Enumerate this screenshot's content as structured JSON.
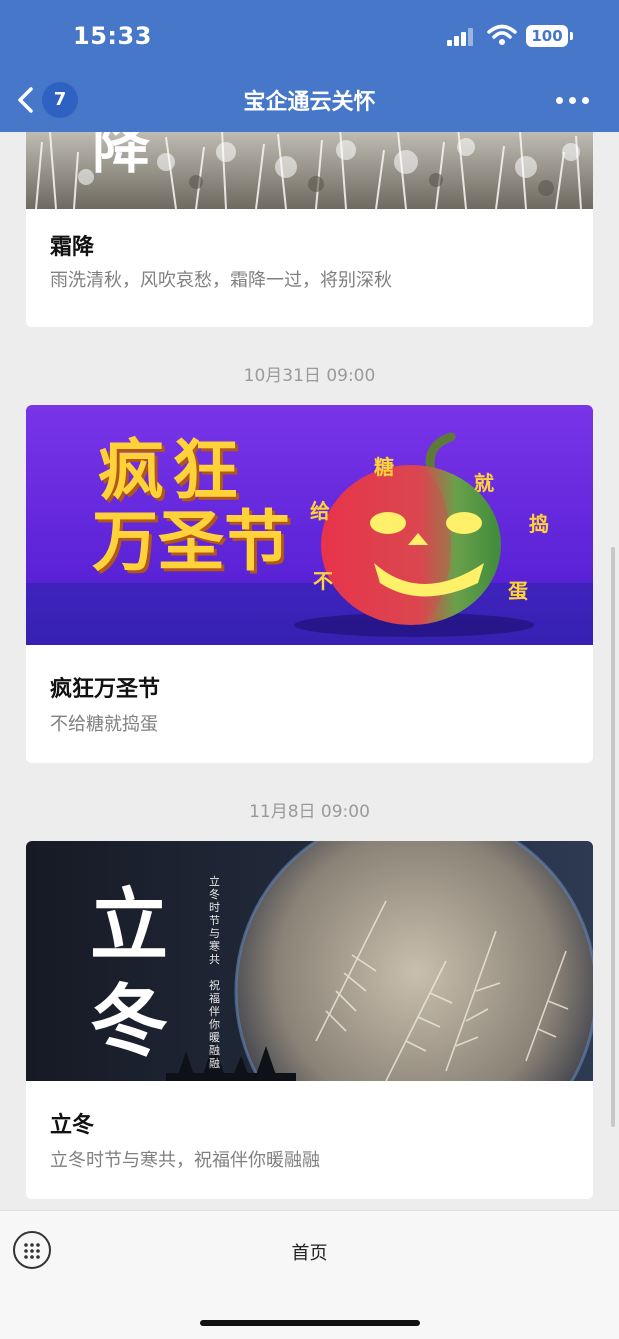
{
  "status_bar": {
    "time": "15:33",
    "battery": "100"
  },
  "header": {
    "back_badge": "7",
    "title": "宝企通云关怀"
  },
  "feed": [
    {
      "title": "霜降",
      "desc": "雨洗清秋，风吹哀愁，霜降一过，将别深秋",
      "image_text": "降"
    },
    {
      "timestamp": "10月31日 09:00",
      "title": "疯狂万圣节",
      "desc": "不给糖就捣蛋",
      "image_text_line1": "疯狂",
      "image_text_line2": "万圣节",
      "pumpkin_chars": [
        "不",
        "给",
        "糖",
        "就",
        "捣",
        "蛋"
      ]
    },
    {
      "timestamp": "11月8日 09:00",
      "title": "立冬",
      "desc": "立冬时节与寒共，祝福伴你暖融融",
      "image_big_1": "立",
      "image_big_2": "冬",
      "image_vertical_1": "立冬时节与寒共",
      "image_vertical_2": "祝福伴你暖融融"
    }
  ],
  "bottom_bar": {
    "home_label": "首页"
  },
  "colors": {
    "header_bg": "#4677c8",
    "badge_bg": "#2e62c2",
    "halloween_bg": "#6d2fe0",
    "winter_bg": "#1a1d26"
  }
}
